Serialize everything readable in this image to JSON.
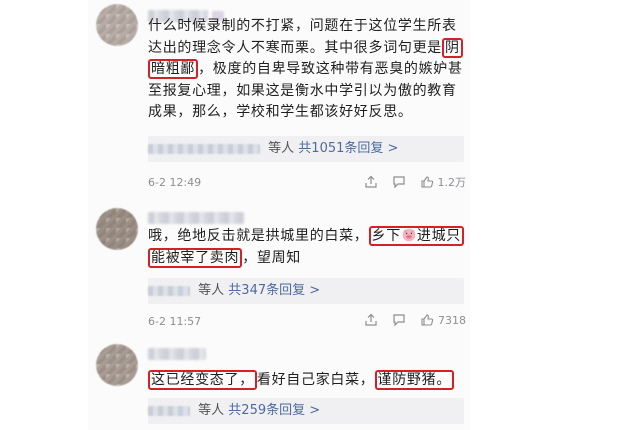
{
  "comments": [
    {
      "body_rows": [
        [
          {
            "t": "什么时候录制的不打紧，问题在于这位学生所表"
          }
        ],
        [
          {
            "t": "达出的理念令人不寒而栗。其中很多词句更是"
          },
          {
            "t": "阴",
            "hl": true
          }
        ],
        [
          {
            "t": "暗粗鄙",
            "hl": true
          },
          {
            "t": "，极度的自卑导致这种带有恶臭的嫉妒甚"
          }
        ],
        [
          {
            "t": "至报复心理，如果这是衡水中学引以为傲的教育"
          }
        ],
        [
          {
            "t": "成果，那么，学校和学生都该好好反思。"
          }
        ]
      ],
      "reply": {
        "suffix": "等人",
        "link": "共1051条回复 >"
      },
      "time": "6-2 12:49",
      "like_count": "1.2万"
    },
    {
      "body_rows": [
        [
          {
            "t": "哦，绝地反击就是拱城里的白菜，"
          },
          {
            "t": "乡下",
            "hl": true,
            "pig_after": true
          },
          {
            "t": "进城只",
            "hl_cont": true
          }
        ],
        [
          {
            "t": "能被宰了卖肉",
            "hl": true
          },
          {
            "t": "，望周知"
          }
        ]
      ],
      "reply": {
        "suffix": "等人",
        "link": "共347条回复 >"
      },
      "time": "6-2 11:57",
      "like_count": "7318"
    },
    {
      "body_rows": [
        [
          {
            "t": "这已经变态了，",
            "hl": true
          },
          {
            "t": "看好自己家白菜，"
          },
          {
            "t": "谨防野猪。",
            "hl": true
          }
        ]
      ],
      "reply": {
        "suffix": "等人",
        "link": "共259条回复 >"
      }
    }
  ],
  "icons": {
    "share": "share-icon",
    "comment": "comment-icon",
    "like": "thumbs-up-icon",
    "emoji": "pig-face-emoji"
  },
  "colors": {
    "highlight": "#d32128",
    "link": "#4d6b9c",
    "meta": "#8e8e93"
  }
}
